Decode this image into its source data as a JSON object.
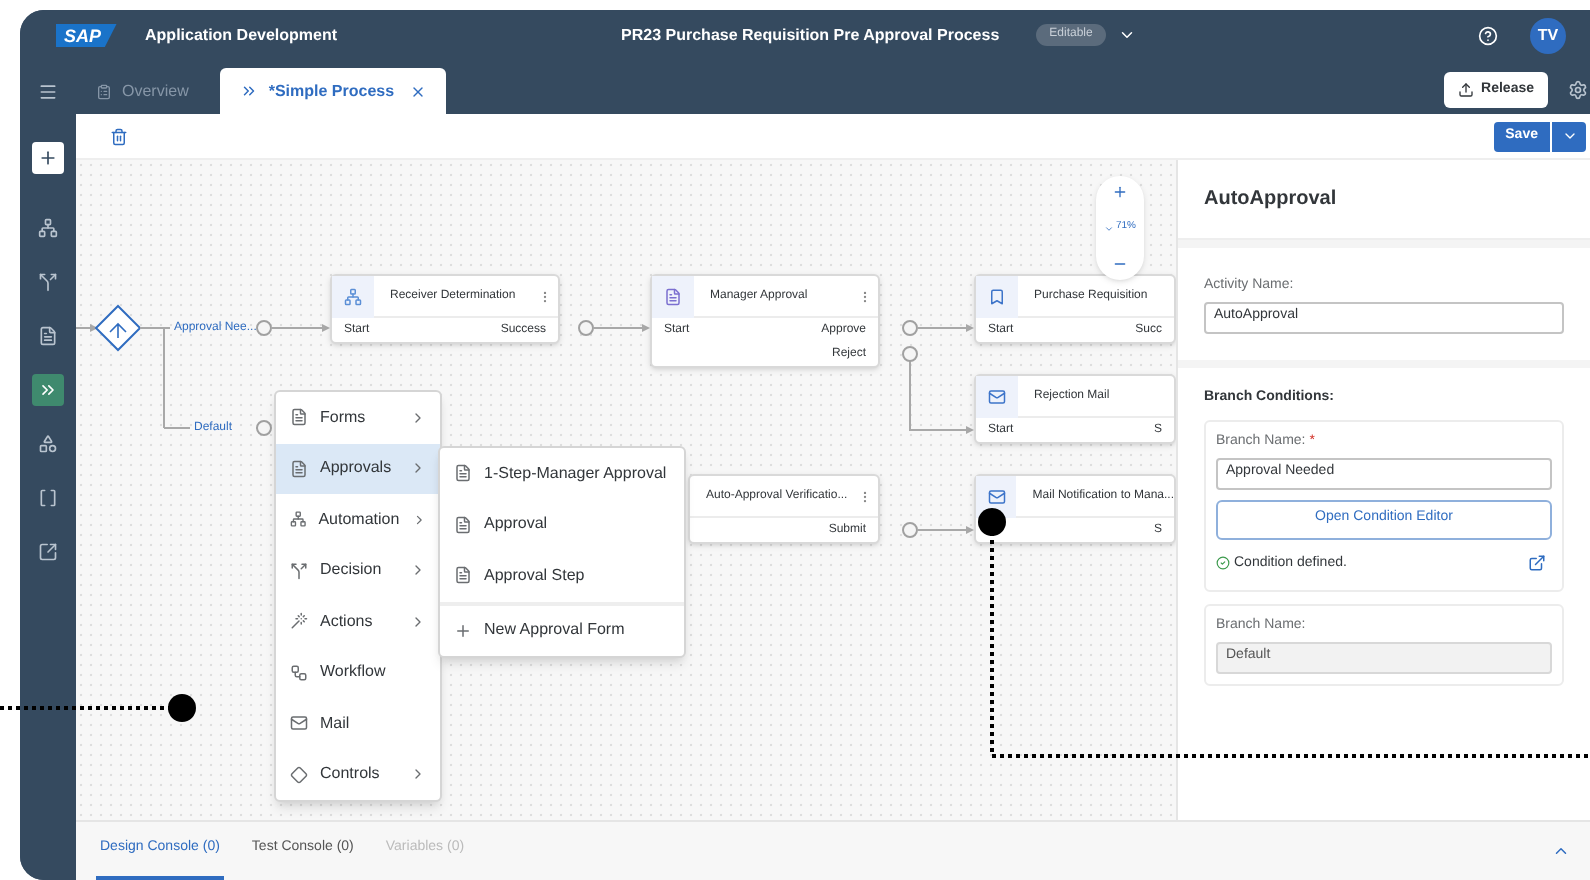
{
  "header": {
    "logo": "SAP",
    "app_name": "Application Development",
    "title": "PR23 Purchase Requisition Pre Approval Process",
    "status_badge": "Editable",
    "avatar": "TV"
  },
  "sidebar_items": [
    {
      "kind": "menu",
      "selected": false
    },
    {
      "kind": "add",
      "selected": false
    },
    {
      "kind": "people",
      "selected": false
    },
    {
      "kind": "decision",
      "selected": false
    },
    {
      "kind": "form",
      "selected": false
    },
    {
      "kind": "process",
      "selected": true
    },
    {
      "kind": "automation",
      "selected": false
    },
    {
      "kind": "variables",
      "selected": false
    },
    {
      "kind": "export",
      "selected": false
    }
  ],
  "tabs": [
    {
      "label": "Overview",
      "selected": false,
      "kind": "overview"
    },
    {
      "label": "*Simple Process",
      "selected": true,
      "kind": "process"
    }
  ],
  "release_button": "Release",
  "save_button": "Save",
  "diagram": {
    "edge_labels": [
      "Approval Nee...",
      "Default"
    ],
    "zoom": "71%",
    "nodes": [
      {
        "title": "Receiver Determination",
        "kind": "automation",
        "rows": [
          {
            "left": "Start",
            "right": "Success"
          }
        ]
      },
      {
        "title": "Manager Approval",
        "kind": "approval",
        "rows": [
          {
            "left": "Start",
            "right": "Approve"
          },
          {
            "right": "Reject"
          }
        ]
      },
      {
        "title": "Purchase Requisition",
        "kind": "form",
        "rows": [
          {
            "left": "Start",
            "right": "Succ"
          }
        ]
      },
      {
        "title": "Rejection Mail",
        "kind": "mail",
        "rows": [
          {
            "left": "Start",
            "right": "S"
          }
        ]
      },
      {
        "title": "Auto-Approval Verificatio...",
        "rows": [
          {
            "right": "Submit"
          }
        ]
      },
      {
        "title": "Mail Notification to Mana...",
        "kind": "mail",
        "rows": [
          {
            "right": "S"
          }
        ]
      }
    ]
  },
  "context_menu": {
    "items": [
      {
        "label": "Forms",
        "kind": "form",
        "submenu": true,
        "selected": false
      },
      {
        "label": "Approvals",
        "kind": "form",
        "submenu": true,
        "selected": true
      },
      {
        "label": "Automation",
        "kind": "automation",
        "submenu": true,
        "selected": false
      },
      {
        "label": "Decision",
        "kind": "decision",
        "submenu": true,
        "selected": false
      },
      {
        "label": "Actions",
        "kind": "actions",
        "submenu": true,
        "selected": false
      },
      {
        "label": "Workflow",
        "kind": "workflow",
        "submenu": false,
        "selected": false
      },
      {
        "label": "Mail",
        "kind": "mail",
        "submenu": false,
        "selected": false
      },
      {
        "label": "Controls",
        "kind": "controls",
        "submenu": true,
        "selected": false
      }
    ],
    "submenu": [
      {
        "label": "1-Step-Manager Approval",
        "kind": "form"
      },
      {
        "label": "Approval",
        "kind": "form"
      },
      {
        "label": "Approval Step",
        "kind": "form"
      },
      {
        "label": "New Approval Form",
        "kind": "add"
      }
    ]
  },
  "panel": {
    "title": "AutoApproval",
    "activity_label": "Activity Name:",
    "activity_value": "AutoApproval",
    "branch_heading": "Branch Conditions:",
    "branches": [
      {
        "label": "Branch Name:",
        "required_mark": "*",
        "value": "Approval Needed",
        "disabled": false,
        "button": "Open Condition Editor",
        "status": "Condition defined."
      },
      {
        "label": "Branch Name:",
        "value": "Default",
        "disabled": true
      }
    ]
  },
  "console_tabs": [
    {
      "label": "Design Console (0)",
      "selected": true,
      "disabled": false
    },
    {
      "label": "Test Console (0)",
      "selected": false,
      "disabled": false
    },
    {
      "label": "Variables (0)",
      "selected": false,
      "disabled": true
    }
  ]
}
